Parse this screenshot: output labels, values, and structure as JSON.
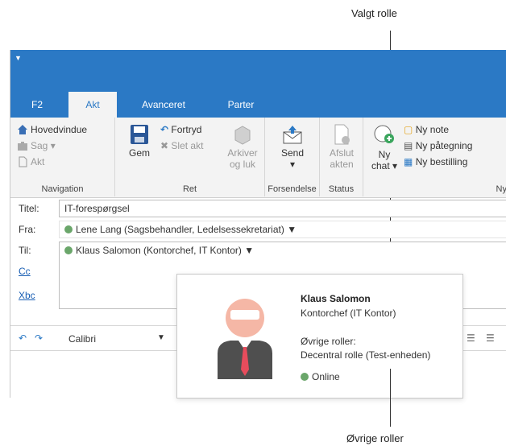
{
  "callouts": {
    "top": "Valgt rolle",
    "bottom": "Øvrige roller"
  },
  "tabs": [
    "F2",
    "Akt",
    "Avanceret",
    "Parter"
  ],
  "ribbon": {
    "navigation": {
      "items": [
        "Hovedvindue",
        "Sag",
        "Akt"
      ],
      "label": "Navigation"
    },
    "ret": {
      "gem": "Gem",
      "fortryd": "Fortryd",
      "slet": "Slet akt",
      "arkiver1": "Arkiver",
      "arkiver2": "og luk",
      "label": "Ret"
    },
    "forsendelse": {
      "send": "Send",
      "label": "Forsendelse"
    },
    "status": {
      "afslut1": "Afslut",
      "afslut2": "akten",
      "label": "Status"
    },
    "ny": {
      "chat1": "Ny",
      "chat2": "chat",
      "note": "Ny note",
      "paategning": "Ny påtegning",
      "bestilling": "Ny bestilling",
      "label": "Ny"
    }
  },
  "form": {
    "titel_label": "Titel:",
    "titel_value": "IT-forespørgsel",
    "fra_label": "Fra:",
    "fra_value": "Lene Lang (Sagsbehandler, Ledelsessekretariat)",
    "til_label": "Til:",
    "til_value": "Klaus Salomon (Kontorchef, IT Kontor)",
    "cc_label": "Cc",
    "xbc_label": "Xbc"
  },
  "editor": {
    "font": "Calibri"
  },
  "card": {
    "name": "Klaus Salomon",
    "role": "Kontorchef (IT Kontor)",
    "other_roles_label": "Øvrige roller:",
    "other_roles_value": "Decentral rolle (Test-enheden)",
    "status": "Online",
    "status_color": "#6aa66a"
  }
}
